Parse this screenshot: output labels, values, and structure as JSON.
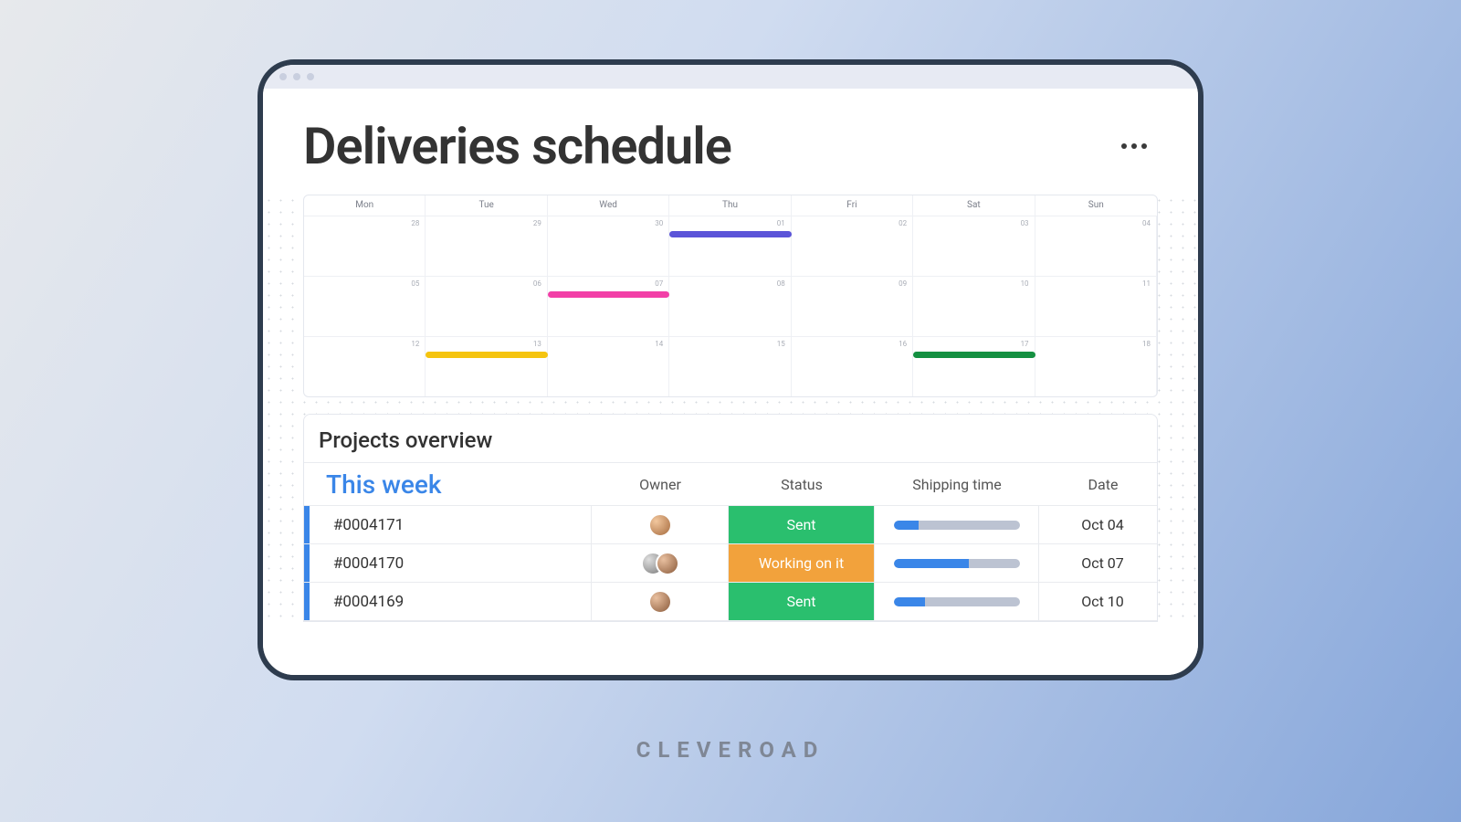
{
  "page": {
    "title": "Deliveries schedule"
  },
  "calendar": {
    "days": [
      "Mon",
      "Tue",
      "Wed",
      "Thu",
      "Fri",
      "Sat",
      "Sun"
    ],
    "rows": [
      [
        "28",
        "29",
        "30",
        "01",
        "02",
        "03",
        "04"
      ],
      [
        "05",
        "06",
        "07",
        "08",
        "09",
        "10",
        "11"
      ],
      [
        "12",
        "13",
        "14",
        "15",
        "16",
        "17",
        "18"
      ]
    ],
    "events": [
      {
        "row": 0,
        "start": 3,
        "span": 1,
        "color": "#5b54d8"
      },
      {
        "row": 1,
        "start": 2,
        "span": 1,
        "color": "#f23fa7"
      },
      {
        "row": 2,
        "start": 1,
        "span": 1,
        "color": "#f5c40f"
      },
      {
        "row": 2,
        "start": 5,
        "span": 1,
        "color": "#149041"
      }
    ]
  },
  "projects": {
    "title": "Projects overview",
    "group": "This week",
    "columns": {
      "owner": "Owner",
      "status": "Status",
      "shipping": "Shipping time",
      "date": "Date"
    },
    "rows": [
      {
        "id": "#0004171",
        "owners": 1,
        "status": "Sent",
        "statusColor": "#2abf6e",
        "ship": 20,
        "date": "Oct 04"
      },
      {
        "id": "#0004170",
        "owners": 2,
        "status": "Working on it",
        "statusColor": "#f2a23c",
        "ship": 60,
        "date": "Oct 07"
      },
      {
        "id": "#0004169",
        "owners": 1,
        "status": "Sent",
        "statusColor": "#2abf6e",
        "ship": 25,
        "date": "Oct 10"
      }
    ]
  },
  "brand": "CLEVEROAD"
}
